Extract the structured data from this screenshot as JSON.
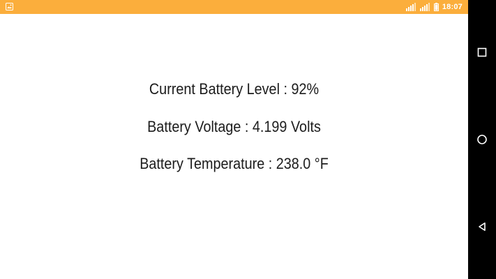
{
  "status_bar": {
    "time": "18:07",
    "icons": [
      "image-notification-icon",
      "signal-icon",
      "signal-icon",
      "battery-icon"
    ],
    "background_color": "#fbae3c"
  },
  "battery_info": {
    "level_line": "Current Battery Level : 92%",
    "voltage_line": "Battery Voltage : 4.199 Volts",
    "temperature_line": "Battery Temperature : 238.0 °F"
  },
  "nav_bar": {
    "buttons": [
      "recents-icon",
      "home-icon",
      "back-icon"
    ],
    "background_color": "#000000"
  }
}
